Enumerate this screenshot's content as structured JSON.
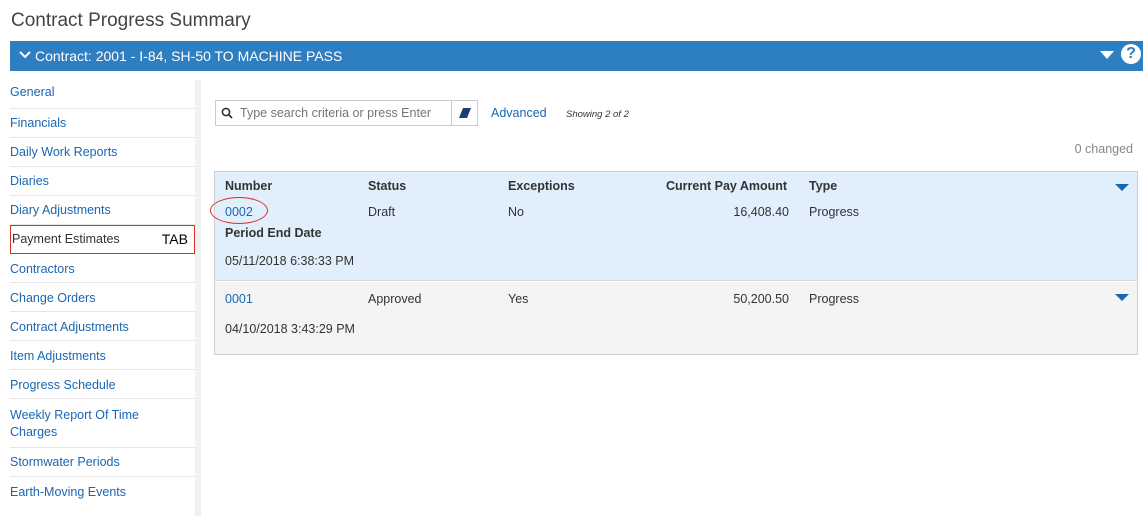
{
  "page": {
    "title": "Contract Progress Summary"
  },
  "contract_bar": {
    "label": "Contract: 2001 - I-84, SH-50 TO MACHINE PASS",
    "help": "?"
  },
  "sidebar": {
    "items": [
      {
        "label": "General"
      },
      {
        "label": "Financials"
      },
      {
        "label": "Daily Work Reports"
      },
      {
        "label": "Diaries"
      },
      {
        "label": "Diary Adjustments"
      },
      {
        "label": "Payment Estimates"
      },
      {
        "label": "Contractors"
      },
      {
        "label": "Change Orders"
      },
      {
        "label": "Contract Adjustments"
      },
      {
        "label": "Item Adjustments"
      },
      {
        "label": "Progress Schedule"
      },
      {
        "label": "Weekly Report Of Time Charges"
      },
      {
        "label": "Stormwater Periods"
      },
      {
        "label": "Earth-Moving Events"
      }
    ],
    "tab_annotation": "TAB"
  },
  "search": {
    "placeholder": "Type search criteria or press Enter",
    "advanced_label": "Advanced",
    "showing": "Showing 2 of 2",
    "changed": "0 changed"
  },
  "grid": {
    "headers": {
      "number": "Number",
      "status": "Status",
      "exceptions": "Exceptions",
      "current_pay_amount": "Current Pay Amount",
      "type": "Type",
      "period_end_date": "Period End Date"
    },
    "rows": [
      {
        "number": "0002",
        "status": "Draft",
        "exceptions": "No",
        "current_pay_amount": "16,408.40",
        "type": "Progress",
        "period_end_date": "05/11/2018 6:38:33 PM"
      },
      {
        "number": "0001",
        "status": "Approved",
        "exceptions": "Yes",
        "current_pay_amount": "50,200.50",
        "type": "Progress",
        "period_end_date": "04/10/2018 3:43:29 PM"
      }
    ]
  }
}
